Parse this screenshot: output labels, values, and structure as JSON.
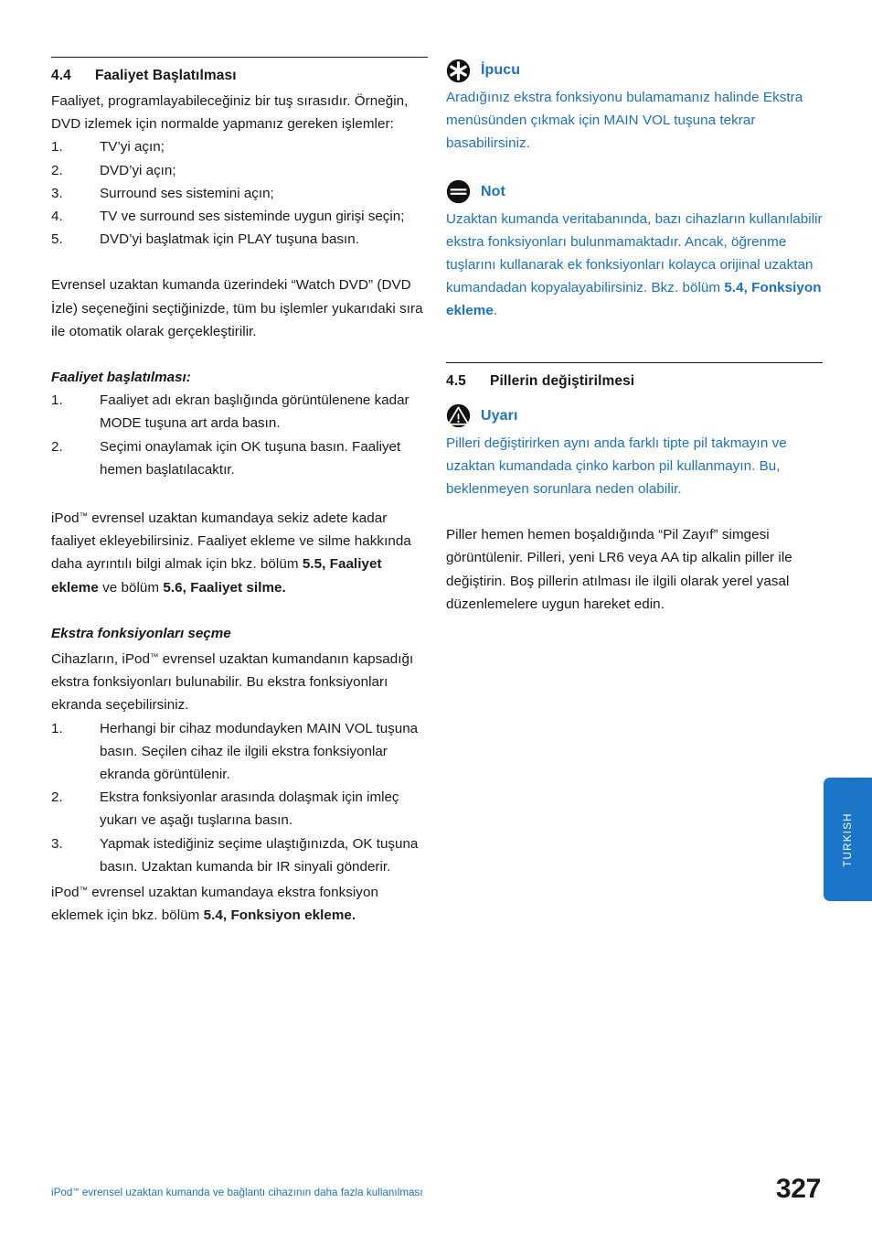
{
  "left_column": {
    "section": {
      "number": "4.4",
      "title": "Faaliyet Başlatılması"
    },
    "intro_paragraph": "Faaliyet, programlayabileceğiniz bir tuş sırasıdır. Örneğin, DVD izlemek için normalde yapmanız gereken işlemler:",
    "intro_steps": [
      {
        "marker": "1.",
        "text": "TV’yi açın;"
      },
      {
        "marker": "2.",
        "text": "DVD’yi açın;"
      },
      {
        "marker": "3.",
        "text": "Surround ses sistemini açın;"
      },
      {
        "marker": "4.",
        "text": "TV ve surround ses sisteminde uygun girişi seçin;"
      },
      {
        "marker": "5.",
        "text": "DVD’yi başlatmak için PLAY tuşuna basın."
      }
    ],
    "watch_dvd_paragraph": "Evrensel uzaktan kumanda üzerindeki “Watch DVD” (DVD İzle) seçeneğini seçtiğinizde, tüm bu işlemler yukarıdaki sıra ile otomatik olarak gerçekleştirilir.",
    "activity_start_heading": "Faaliyet başlatılması:",
    "activity_steps": [
      {
        "marker": "1.",
        "text": "Faaliyet adı ekran başlığında görüntülenene kadar MODE tuşuna art arda basın."
      },
      {
        "marker": "2.",
        "text": "Seçimi onaylamak için OK tuşuna basın. Faaliyet hemen başlatılacaktır."
      }
    ],
    "ipod_paragraph": {
      "part1": "iPod",
      "tm": "™",
      "part2": " evrensel uzaktan kumandaya sekiz adete kadar faaliyet ekleyebilirsiniz. Faaliyet ekleme ve silme hakkında daha ayrıntılı bilgi almak için bkz. bölüm ",
      "bold1": "5.5, Faaliyet ekleme",
      "part3": " ve bölüm ",
      "bold2": "5.6, Faaliyet silme."
    },
    "extra_functions_heading": "Ekstra fonksiyonları seçme",
    "extra_functions_paragraph": {
      "part1": "Cihazların, iPod",
      "tm": "™",
      "part2": " evrensel uzaktan kumandanın kapsadığı ekstra fonksiyonları bulunabilir. Bu ekstra fonksiyonları ekranda seçebilirsiniz."
    },
    "extra_steps": [
      {
        "marker": "1.",
        "text": "Herhangi bir cihaz modundayken MAIN VOL tuşuna basın. Seçilen cihaz ile ilgili ekstra fonksiyonlar ekranda görüntülenir."
      },
      {
        "marker": "2.",
        "text": "Ekstra fonksiyonlar arasında dolaşmak için imleç yukarı ve aşağı tuşlarına basın."
      },
      {
        "marker": "3.",
        "text": "Yapmak istediğiniz seçime ulaştığınızda, OK tuşuna basın. Uzaktan kumanda bir IR sinyali gönderir."
      }
    ],
    "closing_paragraph": {
      "part1": "iPod",
      "tm": "™",
      "part2": " evrensel uzaktan kumandaya ekstra fonksiyon eklemek için bkz. bölüm ",
      "bold1": "5.4, Fonksiyon ekleme."
    }
  },
  "right_column": {
    "tip": {
      "icon": "asterisk-circle-icon",
      "label": "İpucu",
      "text": "Aradığınız ekstra fonksiyonu bulamamanız halinde Ekstra menüsünden çıkmak için MAIN VOL tuşuna tekrar basabilirsiniz."
    },
    "note": {
      "icon": "note-lines-circle-icon",
      "label": "Not",
      "text_part1": "Uzaktan kumanda veritabanında, bazı cihazların kullanılabilir ekstra fonksiyonları bulunmamaktadır. Ancak, öğrenme tuşlarını kullanarak ek fonksiyonları kolayca orijinal uzaktan kumandadan kopyalayabilirsiniz. Bkz. bölüm ",
      "text_bold": "5.4, Fonksiyon ekleme",
      "text_part2": "."
    },
    "section": {
      "number": "4.5",
      "title": "Pillerin değiştirilmesi"
    },
    "warning": {
      "icon": "warning-triangle-circle-icon",
      "label": "Uyarı",
      "text": "Pilleri değiştirirken aynı anda farklı tipte pil takmayın ve uzaktan kumandada çinko karbon pil kullanmayın. Bu, beklenmeyen sorunlara neden olabilir."
    },
    "battery_paragraph": "Piller hemen hemen boşaldığında “Pil Zayıf” simgesi görüntülenir. Pilleri, yeni LR6 veya AA tip alkalin piller ile değiştirin. Boş pillerin atılması ile ilgili olarak yerel yasal düzenlemelere uygun hareket edin."
  },
  "side_tab": {
    "label": "TURKISH",
    "color": "#1b76c9"
  },
  "footer": {
    "text_part1": "iPod",
    "tm": "™",
    "text_part2": " evrensel uzaktan kumanda ve bağlantı cihazının daha fazla kullanılması",
    "page_number": "327",
    "text_color": "#1b72c4"
  }
}
